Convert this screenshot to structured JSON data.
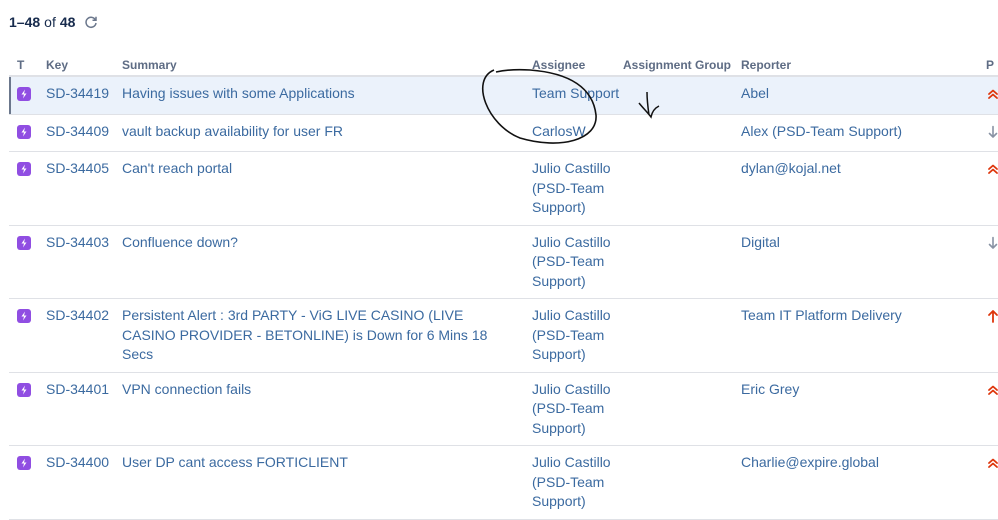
{
  "pager": {
    "range": "1–48",
    "of": "of",
    "total": "48",
    "refresh_icon": "refresh-icon"
  },
  "columns": {
    "type": "T",
    "key": "Key",
    "summary": "Summary",
    "assignee": "Assignee",
    "group": "Assignment Group",
    "reporter": "Reporter",
    "priority": "P"
  },
  "rows": [
    {
      "key": "SD-34419",
      "summary": "Having issues with some Applications",
      "assignee": "Team Support",
      "reporter": "Abel",
      "priority": "highest",
      "selected": true
    },
    {
      "key": "SD-34409",
      "summary": "vault backup availability for user FR",
      "assignee": "CarlosW",
      "reporter": "Alex (PSD-Team Support)",
      "priority": "low"
    },
    {
      "key": "SD-34405",
      "summary": "Can't reach portal",
      "assignee": "Julio Castillo (PSD-Team Support)",
      "reporter": "dylan@kojal.net",
      "priority": "highest"
    },
    {
      "key": "SD-34403",
      "summary": "Confluence down?",
      "assignee": "Julio Castillo (PSD-Team Support)",
      "reporter": "Digital",
      "priority": "low"
    },
    {
      "key": "SD-34402",
      "summary": "Persistent Alert : 3rd PARTY - ViG LIVE CASINO (LIVE CASINO PROVIDER - BETONLINE) is Down for 6 Mins 18 Secs",
      "assignee": "Julio Castillo (PSD-Team Support)",
      "reporter": "Team IT Platform Delivery",
      "priority": "high"
    },
    {
      "key": "SD-34401",
      "summary": "VPN connection fails",
      "assignee": "Julio Castillo (PSD-Team Support)",
      "reporter": "Eric Grey",
      "priority": "highest"
    },
    {
      "key": "SD-34400",
      "summary": "User DP cant access FORTICLIENT",
      "assignee": "Julio Castillo (PSD-Team Support)",
      "reporter": "Charlie@expire.global",
      "priority": "highest"
    }
  ],
  "colors": {
    "link": "#3b6aa0",
    "type_icon": "#904ee2",
    "priority_red": "#de350b",
    "priority_low": "#8993a4",
    "selected_row": "#ebf2fb"
  }
}
